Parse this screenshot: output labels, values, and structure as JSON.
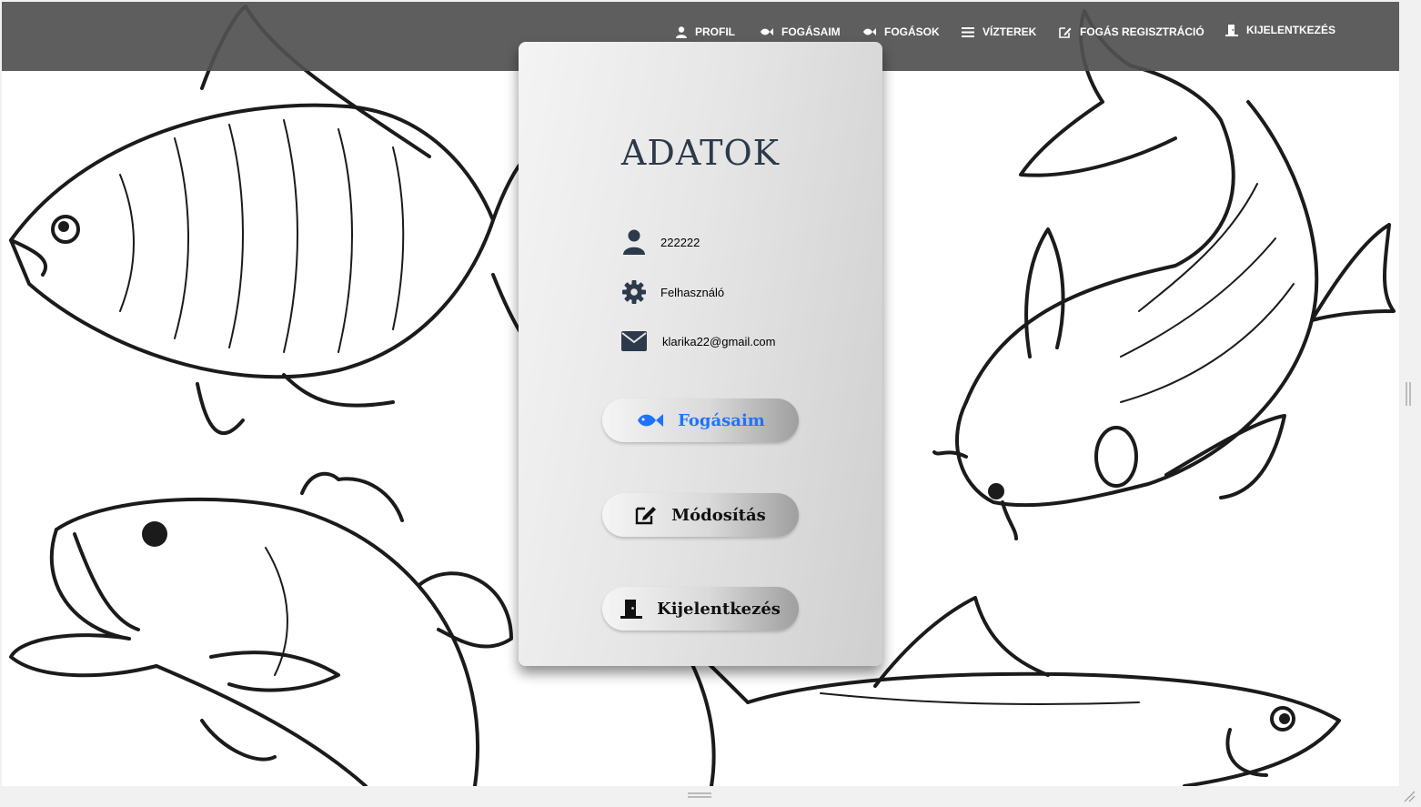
{
  "nav": {
    "items": [
      {
        "label": "PROFIL",
        "icon": "user-icon"
      },
      {
        "label": "FOGÁSAIM",
        "icon": "fish-icon"
      },
      {
        "label": "FOGÁSOK",
        "icon": "fish-icon"
      },
      {
        "label": "VÍZTEREK",
        "icon": "list-icon"
      },
      {
        "label": "FOGÁS REGISZTRÁCIÓ",
        "icon": "edit-icon"
      },
      {
        "label": "KIJELENTKEZÉS",
        "icon": "door-exit-icon"
      }
    ]
  },
  "card": {
    "title": "ADATOK",
    "username": "222222",
    "role": "Felhasználó",
    "email": "klarika22@gmail.com",
    "buttons": {
      "catches": "Fogásaim",
      "edit": "Módosítás",
      "logout": "Kijelentkezés"
    }
  },
  "colors": {
    "navbar": "#505050",
    "title": "#2c3a4b",
    "link_blue": "#1e73ff",
    "icon_dark": "#2c3a4b"
  }
}
